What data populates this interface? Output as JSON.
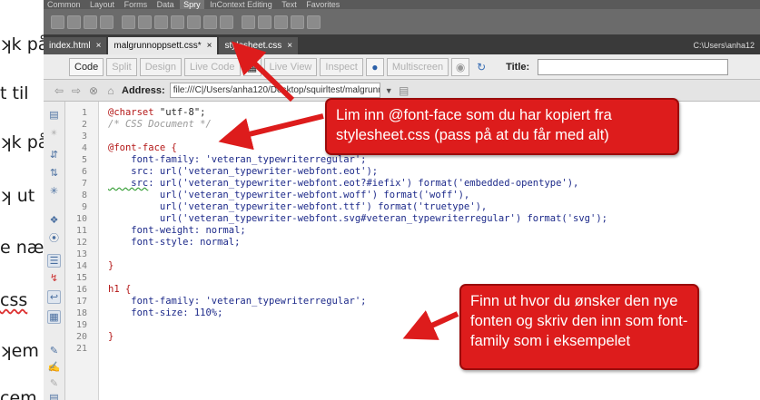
{
  "left_fragments": [
    "ʞk på",
    "t til",
    "ʞk på",
    "ʞ ut",
    "e næ",
    "css",
    "ʞem",
    "cem"
  ],
  "insert_tabs": [
    "Common",
    "Layout",
    "Forms",
    "Data",
    "Spry",
    "InContext Editing",
    "Text",
    "Favorites"
  ],
  "doc_tabs": [
    {
      "label": "index.html",
      "close": "×"
    },
    {
      "label": "malgrunnoppsett.css*",
      "close": "×"
    },
    {
      "label": "stylesheet.css",
      "close": "×"
    }
  ],
  "path_text": "C:\\Users\\anha12",
  "toolbar": {
    "code": "Code",
    "split": "Split",
    "design": "Design",
    "live_code": "Live Code",
    "live_view": "Live View",
    "inspect": "Inspect",
    "multiscreen": "Multiscreen",
    "title_label": "Title:"
  },
  "address": {
    "label": "Address:",
    "value": "file:///C|/Users/anha120/Desktop/squirltest/malgrunnoppsett"
  },
  "line_numbers": [
    "1",
    "2",
    "3",
    "4",
    "5",
    "6",
    "7",
    "8",
    "9",
    "10",
    "11",
    "12",
    "13",
    "14",
    "15",
    "16",
    "17",
    "18",
    "19",
    "20",
    "21"
  ],
  "code": {
    "l1_atr": "@charset",
    "l1_str": " \"utf-8\";",
    "l2": "/* CSS Document */",
    "l4_sel": "@font-face {",
    "l5_prop": "    font-family",
    "l5_val": ": 'veteran_typewriterregular';",
    "l6_prop": "    src",
    "l6_val": ": url('veteran_typewriter-webfont.eot');",
    "l7_prop": "    src",
    "l7_val": ": url('veteran_typewriter-webfont.eot?#iefix') format('embedded-opentype'),",
    "l8": "         url('veteran_typewriter-webfont.woff') format('woff'),",
    "l9": "         url('veteran_typewriter-webfont.ttf') format('truetype'),",
    "l10": "         url('veteran_typewriter-webfont.svg#veteran_typewriterregular') format('svg');",
    "l11_prop": "    font-weight",
    "l11_val": ": normal;",
    "l12_prop": "    font-style",
    "l12_val": ": normal;",
    "l14": "}",
    "l16_sel": "h1 {",
    "l17_prop": "    font-family",
    "l17_val": ": 'veteran_typewriterregular';",
    "l18_prop": "    font-size",
    "l18_val": ": 110%;",
    "l20": "}"
  },
  "callouts": {
    "first": "Lim inn @font-face som du har kopiert fra stylesheet.css (pass på at du får med alt)",
    "second": "Finn ut hvor du ønsker den nye fonten og skriv den inn som font-family som i eksempelet"
  },
  "colors": {
    "callout": "#dd1c1c",
    "selector": "#b41818",
    "property": "#1d2a8a"
  }
}
